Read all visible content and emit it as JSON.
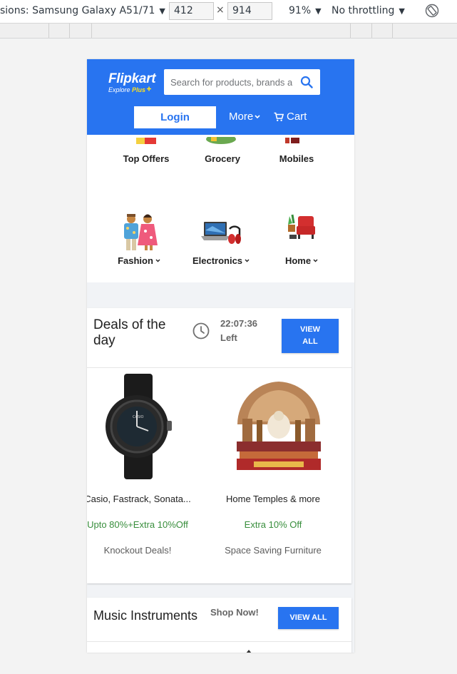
{
  "devtools": {
    "device": "sions: Samsung Galaxy A51/71",
    "width": "412",
    "height": "914",
    "times": "×",
    "zoom": "91%",
    "throttle": "No throttling",
    "caret": "▼"
  },
  "header": {
    "brand": "Flipkart",
    "tagline_a": "Explore",
    "tagline_b": "Plus",
    "search_placeholder": "Search for products, brands and more",
    "login_label": "Login",
    "more_label": "More",
    "cart_label": "Cart",
    "colors": {
      "primary": "#2874f0",
      "plus": "#ffe11b"
    }
  },
  "categories": [
    {
      "label": "Top Offers",
      "has_menu": false
    },
    {
      "label": "Grocery",
      "has_menu": false
    },
    {
      "label": "Mobiles",
      "has_menu": false
    },
    {
      "label": "Fashion",
      "has_menu": true
    },
    {
      "label": "Electronics",
      "has_menu": true
    },
    {
      "label": "Home",
      "has_menu": true
    }
  ],
  "deals": {
    "title": "Deals of the day",
    "timer": "22:07:36",
    "timer_suffix": "Left",
    "view_all": "VIEW ALL",
    "products": [
      {
        "name": "Casio, Fastrack, Sonata...",
        "offer": "Upto 80%+Extra 10%Off",
        "subtitle": "Knockout Deals!"
      },
      {
        "name": "Home Temples & more",
        "offer": "Extra 10% Off",
        "subtitle": "Space Saving Furniture"
      }
    ]
  },
  "music": {
    "title": "Music Instruments",
    "shop_now": "Shop Now!",
    "view_all": "VIEW ALL"
  }
}
